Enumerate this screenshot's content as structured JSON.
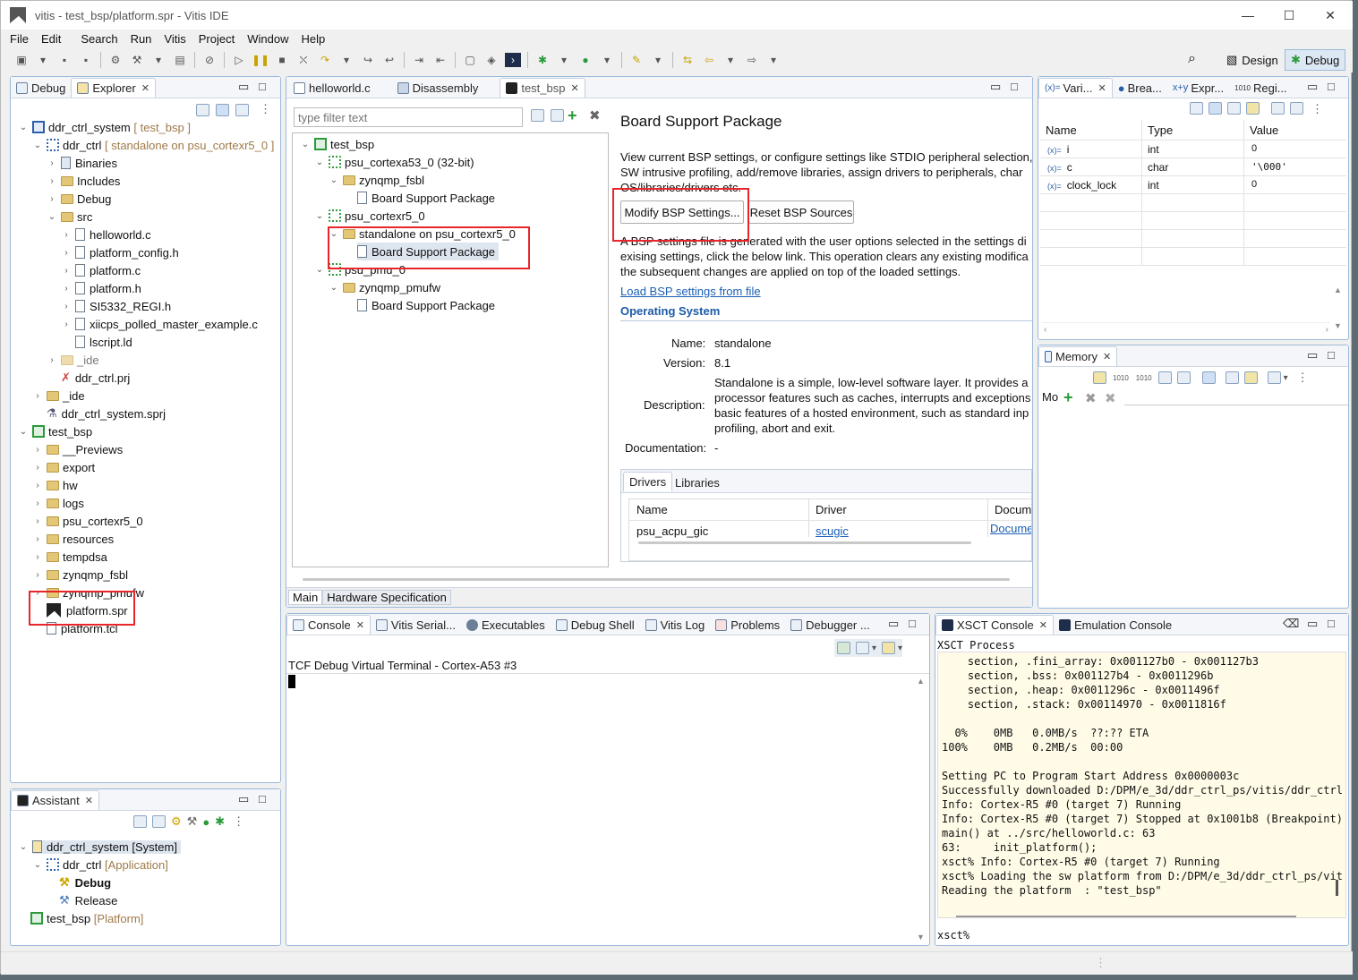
{
  "window": {
    "title": "vitis - test_bsp/platform.spr - Vitis IDE",
    "min": "—",
    "max": "☐",
    "close": "✕"
  },
  "menu": [
    "File",
    "Edit",
    "Search",
    "Run",
    "Vitis",
    "Project",
    "Window",
    "Help"
  ],
  "perspectives": {
    "design": "Design",
    "debug": "Debug"
  },
  "left_panel": {
    "tabs": {
      "debug": "Debug",
      "explorer": "Explorer"
    },
    "tree": [
      {
        "label": "ddr_ctrl_system",
        "suffix": "[ test_bsp ]"
      },
      {
        "label": "ddr_ctrl",
        "suffix": "[ standalone on psu_cortexr5_0 ]"
      },
      {
        "label": "Binaries"
      },
      {
        "label": "Includes"
      },
      {
        "label": "Debug"
      },
      {
        "label": "src"
      },
      {
        "label": "helloworld.c"
      },
      {
        "label": "platform_config.h"
      },
      {
        "label": "platform.c"
      },
      {
        "label": "platform.h"
      },
      {
        "label": "SI5332_REGI.h"
      },
      {
        "label": "xiicps_polled_master_example.c"
      },
      {
        "label": "lscript.ld"
      },
      {
        "label": "_ide"
      },
      {
        "label": "ddr_ctrl.prj"
      },
      {
        "label": "_ide"
      },
      {
        "label": "ddr_ctrl_system.sprj"
      },
      {
        "label": "test_bsp"
      },
      {
        "label": "__Previews"
      },
      {
        "label": "export"
      },
      {
        "label": "hw"
      },
      {
        "label": "logs"
      },
      {
        "label": "psu_cortexr5_0"
      },
      {
        "label": "resources"
      },
      {
        "label": "tempdsa"
      },
      {
        "label": "zynqmp_fsbl"
      },
      {
        "label": "zynqmp_pmufw"
      },
      {
        "label": "platform.spr"
      },
      {
        "label": "platform.tcl"
      }
    ]
  },
  "assistant": {
    "tab": "Assistant",
    "items": [
      {
        "label": "ddr_ctrl_system",
        "suffix": "[System]"
      },
      {
        "label": "ddr_ctrl",
        "suffix": "[Application]"
      },
      {
        "label": "Debug"
      },
      {
        "label": "Release"
      },
      {
        "label": "test_bsp",
        "suffix": "[Platform]"
      }
    ]
  },
  "editor": {
    "tabs": {
      "helloworld": "helloworld.c",
      "disassembly": "Disassembly",
      "bsp": "test_bsp"
    },
    "filter_placeholder": "type filter text",
    "bsp_tree": [
      {
        "label": "test_bsp"
      },
      {
        "label": "psu_cortexa53_0 (32-bit)"
      },
      {
        "label": "zynqmp_fsbl"
      },
      {
        "label": "Board Support Package"
      },
      {
        "label": "psu_cortexr5_0"
      },
      {
        "label": "standalone on psu_cortexr5_0"
      },
      {
        "label": "Board Support Package"
      },
      {
        "label": "psu_pmu_0"
      },
      {
        "label": "zynqmp_pmufw"
      },
      {
        "label": "Board Support Package"
      }
    ],
    "heading": "Board Support Package",
    "intro1": "View current BSP settings, or configure settings like STDIO peripheral selection,",
    "intro2": "SW intrusive profiling, add/remove libraries, assign drivers to peripherals, char",
    "intro3": "OS/libraries/drivers etc.",
    "modify_btn": "Modify BSP Settings...",
    "reset_btn": "Reset BSP Sources",
    "note1": "A BSP settings file is generated with the user options selected in the settings di",
    "note2": "exising settings, click the below link. This operation clears any existing modifica",
    "note3": "the subsequent changes are applied on top of the loaded settings.",
    "load_link": "Load BSP settings from file",
    "os_header": "Operating System",
    "name_lbl": "Name:",
    "name_val": "standalone",
    "version_lbl": "Version:",
    "version_val": "8.1",
    "desc_lbl": "Description:",
    "desc1": "Standalone is a simple, low-level software layer. It provides a",
    "desc2": "processor features such as caches, interrupts and exceptions",
    "desc3": "basic features of a hosted environment, such as standard inp",
    "desc4": "profiling, abort and exit.",
    "doc_lbl": "Documentation:",
    "doc_val": "-",
    "drivers_tab": "Drivers",
    "libraries_tab": "Libraries",
    "drv_cols": [
      "Name",
      "Driver",
      "Docume"
    ],
    "drv_row": [
      "psu_acpu_gic",
      "scugic",
      "Docume"
    ],
    "bottom_tabs": [
      "Main",
      "Hardware Specification"
    ]
  },
  "variables": {
    "tabs": [
      "Vari...",
      "Brea...",
      "Expr...",
      "Regi..."
    ],
    "cols": [
      "Name",
      "Type",
      "Value"
    ],
    "rows": [
      [
        "i",
        "int",
        "0"
      ],
      [
        "c",
        "char",
        "'\\000'"
      ],
      [
        "clock_lock",
        "int",
        "0"
      ]
    ]
  },
  "memory": {
    "tab": "Memory",
    "label": "Mo"
  },
  "console": {
    "tabs": [
      "Console",
      "Vitis Serial...",
      "Executables",
      "Debug Shell",
      "Vitis Log",
      "Problems",
      "Debugger ..."
    ],
    "title": "TCF Debug Virtual Terminal - Cortex-A53 #3"
  },
  "xsct": {
    "tabs": [
      "XSCT Console",
      "Emulation Console"
    ],
    "process": "XSCT Process",
    "lines": [
      "    section, .fini_array: 0x001127b0 - 0x001127b3",
      "    section, .bss: 0x001127b4 - 0x0011296b",
      "    section, .heap: 0x0011296c - 0x0011496f",
      "    section, .stack: 0x00114970 - 0x0011816f",
      "",
      "  0%    0MB   0.0MB/s  ??:?? ETA",
      "100%    0MB   0.2MB/s  00:00",
      "",
      "Setting PC to Program Start Address 0x0000003c",
      "Successfully downloaded D:/DPM/e_3d/ddr_ctrl_ps/vitis/ddr_ctrl",
      "Info: Cortex-R5 #0 (target 7) Running",
      "Info: Cortex-R5 #0 (target 7) Stopped at 0x1001b8 (Breakpoint)",
      "main() at ../src/helloworld.c: 63",
      "63:     init_platform();",
      "xsct% Info: Cortex-R5 #0 (target 7) Running",
      "xsct% Loading the sw platform from D:/DPM/e_3d/ddr_ctrl_ps/vit",
      "Reading the platform  : \"test_bsp\""
    ],
    "prompt": "xsct%"
  }
}
